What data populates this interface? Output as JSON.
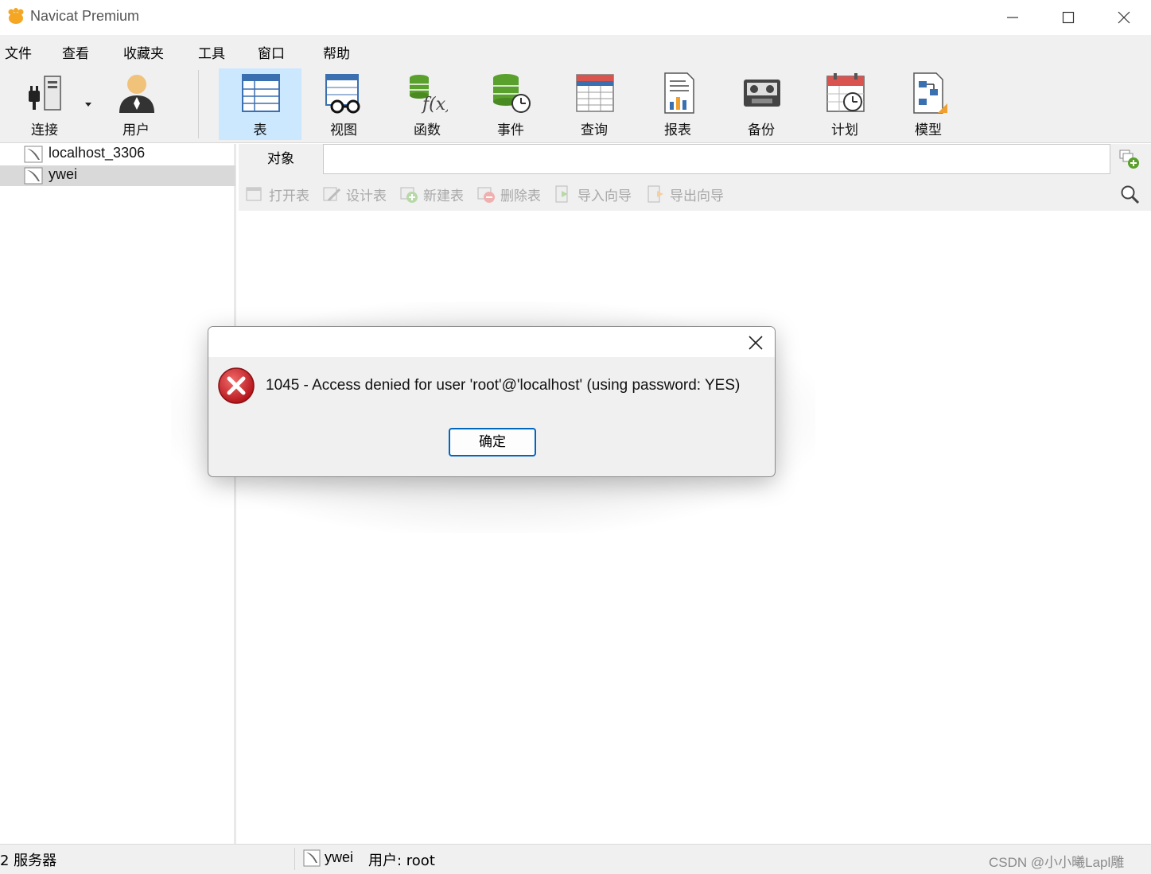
{
  "window": {
    "title": "Navicat Premium"
  },
  "menu": {
    "items": [
      "文件",
      "查看",
      "收藏夹",
      "工具",
      "窗口",
      "帮助"
    ]
  },
  "toolbar": {
    "connect": "连接",
    "user": "用户",
    "table": "表",
    "view": "视图",
    "function": "函数",
    "event": "事件",
    "query": "查询",
    "report": "报表",
    "backup": "备份",
    "schedule": "计划",
    "model": "模型",
    "active_tool": "表"
  },
  "sidebar": {
    "connections": [
      {
        "name": "localhost_3306",
        "selected": false
      },
      {
        "name": "ywei",
        "selected": true
      }
    ]
  },
  "objects": {
    "tab_label": "对象",
    "actions": [
      "打开表",
      "设计表",
      "新建表",
      "删除表",
      "导入向导",
      "导出向导"
    ]
  },
  "statusbar": {
    "server_count": "2 服务器",
    "connection": "ywei",
    "user": "用户: root",
    "watermark": "CSDN @小小曦Lapl雕"
  },
  "dialog": {
    "message": "1045 - Access denied for user 'root'@'localhost' (using password: YES)",
    "ok_label": "确定"
  },
  "colors": {
    "active_tool_bg": "#cce8ff",
    "ok_button_border": "#0067c0",
    "error_icon": "#d21f26",
    "selection_bg": "#d9d9d9"
  }
}
